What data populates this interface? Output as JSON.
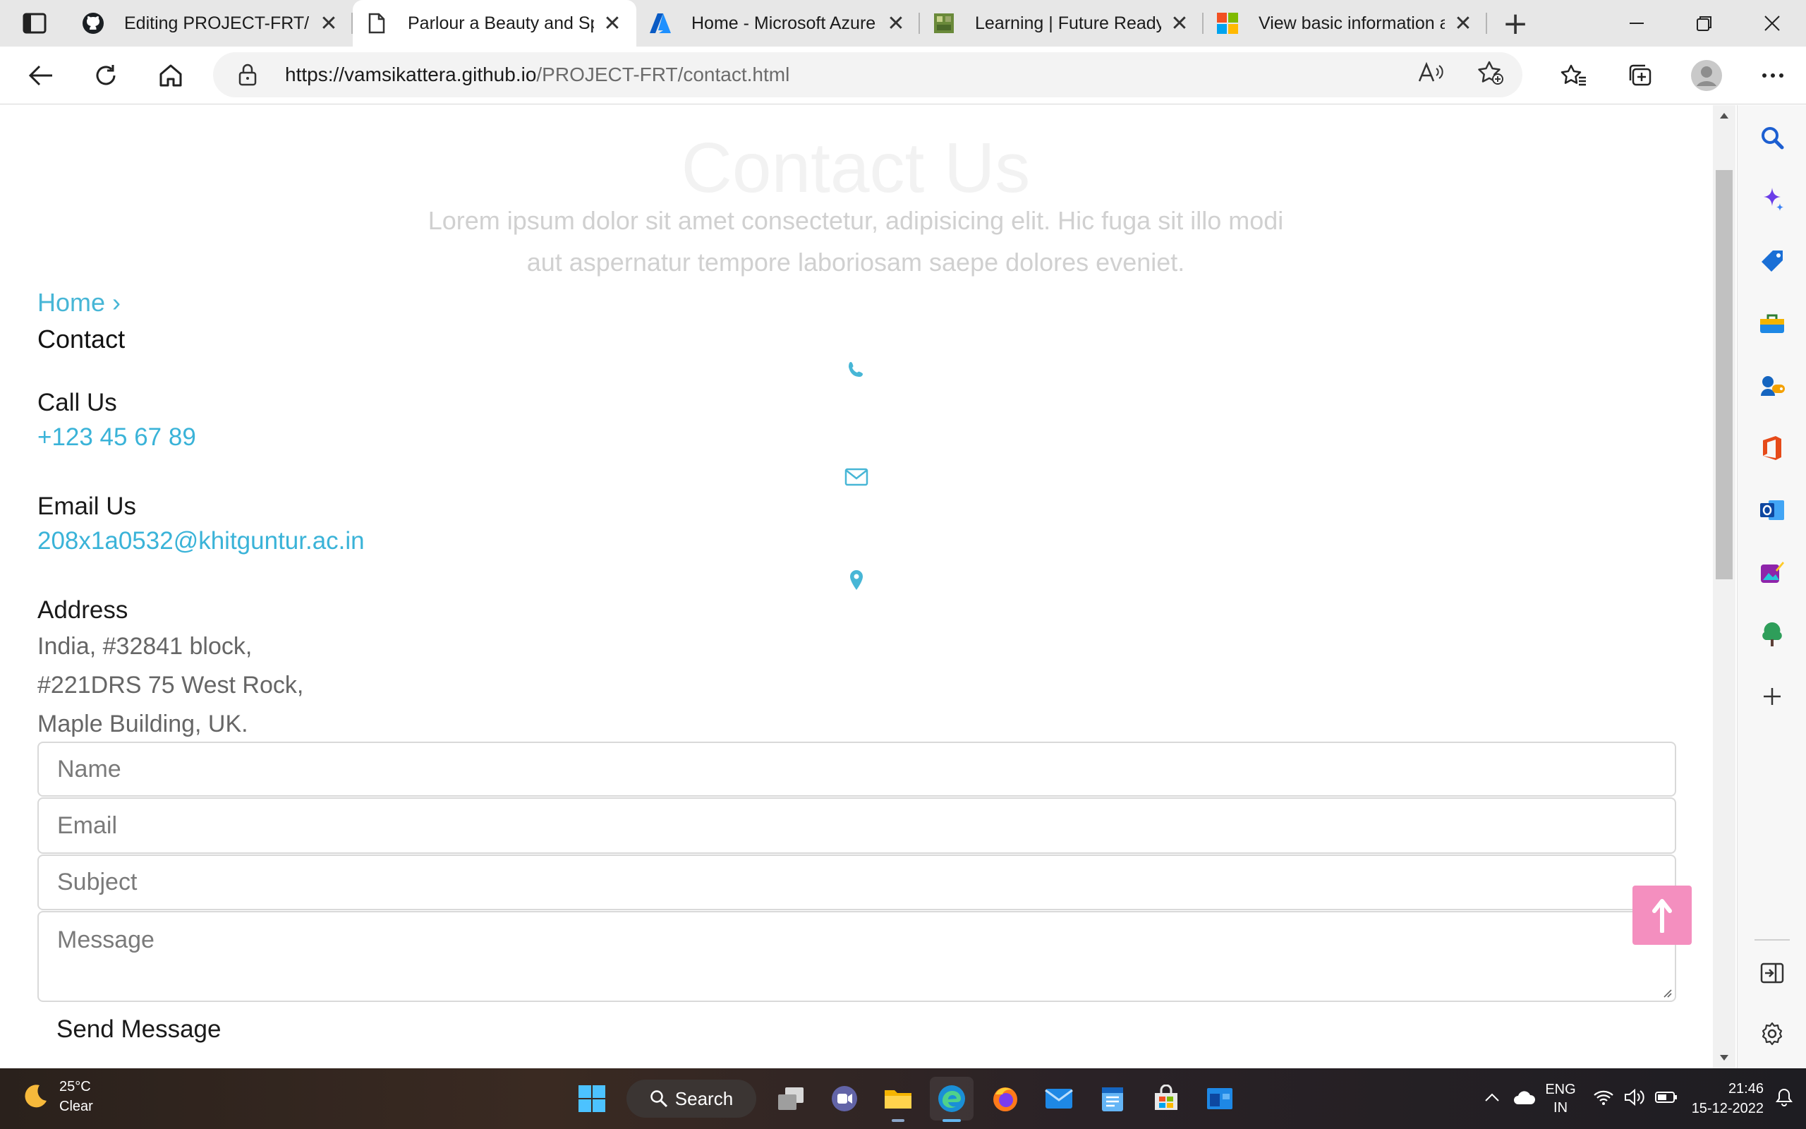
{
  "browser": {
    "tabs": [
      {
        "title": "Editing PROJECT-FRT/RE",
        "favicon": "github-icon",
        "active": false
      },
      {
        "title": "Parlour a Beauty and Sp",
        "favicon": "page-icon",
        "active": true
      },
      {
        "title": "Home - Microsoft Azure",
        "favicon": "azure-icon",
        "active": false
      },
      {
        "title": "Learning | Future Ready",
        "favicon": "future-ready-icon",
        "active": false
      },
      {
        "title": "View basic information a",
        "favicon": "microsoft-icon",
        "active": false
      }
    ],
    "url_host": "https://vamsikattera.github.io",
    "url_path": "/PROJECT-FRT/contact.html"
  },
  "page": {
    "hero_title": "Contact Us",
    "hero_subtitle": "Lorem ipsum dolor sit amet consectetur, adipisicing elit. Hic fuga sit illo modi aut aspernatur tempore laboriosam saepe dolores eveniet.",
    "breadcrumb": {
      "home": "Home",
      "separator": "›",
      "current": "Contact"
    },
    "call": {
      "heading": "Call Us",
      "value": "+123 45 67 89"
    },
    "email": {
      "heading": "Email Us",
      "value": "208x1a0532@khitguntur.ac.in"
    },
    "address": {
      "heading": "Address",
      "line1": "India, #32841 block,",
      "line2": "#221DRS 75 West Rock,",
      "line3": "Maple Building, UK."
    },
    "form": {
      "name_placeholder": "Name",
      "email_placeholder": "Email",
      "subject_placeholder": "Subject",
      "message_placeholder": "Message",
      "send_label": "Send Message"
    },
    "accent_color": "#47b6d6",
    "totop_color": "#f48fbf"
  },
  "taskbar": {
    "weather_temp": "25°C",
    "weather_desc": "Clear",
    "search_label": "Search",
    "lang_top": "ENG",
    "lang_bottom": "IN",
    "time": "21:46",
    "date": "15-12-2022"
  }
}
